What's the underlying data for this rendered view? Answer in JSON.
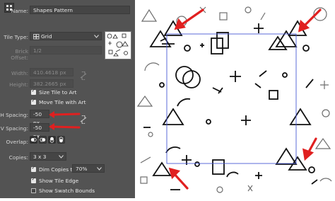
{
  "panel": {
    "name_label": "Name:",
    "name_value": "Shapes Pattern",
    "tile_type_label": "Tile Type:",
    "tile_type_value": "Grid",
    "brick_offset_label": "Brick Offset:",
    "brick_offset_value": "1/2",
    "width_label": "Width:",
    "width_value": "410.4618 px",
    "height_label": "Height:",
    "height_value": "382.2665 px",
    "size_tile_label": "Size Tile to Art",
    "move_tile_label": "Move Tile with Art",
    "h_spacing_label": "H Spacing:",
    "h_spacing_value": "-50 px",
    "v_spacing_label": "V Spacing:",
    "v_spacing_value": "-50 px",
    "overlap_label": "Overlap:",
    "copies_label": "Copies:",
    "copies_value": "3 x 3",
    "dim_copies_label": "Dim Copies to:",
    "dim_copies_value": "70%",
    "show_tile_edge_label": "Show Tile Edge",
    "show_swatch_bounds_label": "Show Swatch Bounds"
  },
  "icons": [
    "grid-tile-icon",
    "link-icon",
    "dropdown-chevron-icon",
    "overlap-icon",
    "arrow-annotation-icon"
  ],
  "colors": {
    "panel_bg": "#535353",
    "field_bg": "#454545",
    "tile_border": "#4a5bd6",
    "arrow": "#e02020"
  }
}
